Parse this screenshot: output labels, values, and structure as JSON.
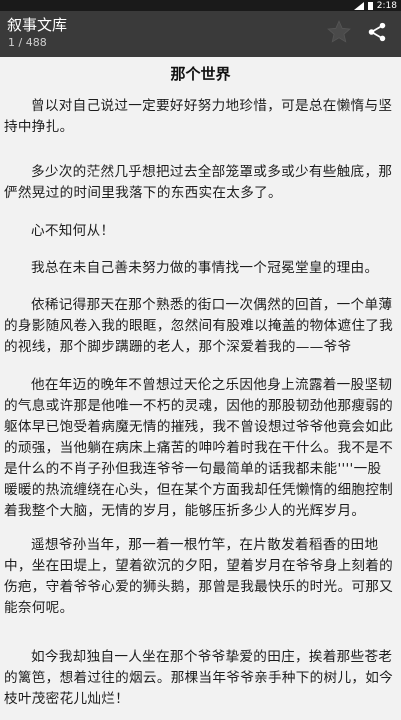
{
  "status_bar": {
    "time": "2:18"
  },
  "app_bar": {
    "title": "叙事文库",
    "page_indicator": "1 / 488",
    "icons": [
      "star-icon",
      "share-icon"
    ]
  },
  "article": {
    "title": "那个世界",
    "paragraphs": [
      "曾以对自己说过一定要好好努力地珍惜，可是总在懒惰与坚持中挣扎。",
      "多少次的茫然几乎想把过去全部笼罩或多或少有些触底，那俨然晃过的时间里我落下的东西实在太多了。",
      "心不知何从！",
      "我总在未自己善未努力做的事情找一个冠冕堂皇的理由。",
      "依稀记得那天在那个熟悉的街口一次偶然的回首，一个单薄的身影随风卷入我的眼眶，忽然间有股难以掩盖的物体遮住了我的视线，那个脚步蹒跚的老人，那个深爱着我的——爷爷",
      "他在年迈的晚年不曾想过天伦之乐因他身上流露着一股坚韧的气息或许那是他唯一不朽的灵魂，因他的那股韧劲他那瘦弱的躯体早已饱受着病魔无情的摧残，我不曾设想过爷爷他竟会如此的顽强，当他躺在病床上痛苦的呻吟着时我在干什么。我不是不是什么的不肖子孙但我连爷爷一句最简单的话我都未能''''一股暖暖的热流缠绕在心头，但在某个方面我却任凭懒惰的细胞控制着我整个大脑，无情的岁月，能够压折多少人的光辉岁月。",
      "遥想爷孙当年，那一着一根竹竿，在片散发着稻香的田地中，坐在田堤上，望着欲沉的夕阳，望着岁月在爷爷身上刻着的伤疤，守着爷爷心爱的狮头鹅，那曾是我最快乐的时光。可那又能奈何呢。",
      "如今我却独自一人坐在那个爷爷挚爱的田庄，挨着那些苍老的篱笆，想着过往的烟云。那棵当年爷爷亲手种下的树儿，如今枝叶茂密花儿灿烂！"
    ]
  },
  "colors": {
    "status_bar": "#1a1a1a",
    "app_bar": "#3a3a3a",
    "page_background": "#f2f2f2",
    "text": "#1d1d1d"
  }
}
